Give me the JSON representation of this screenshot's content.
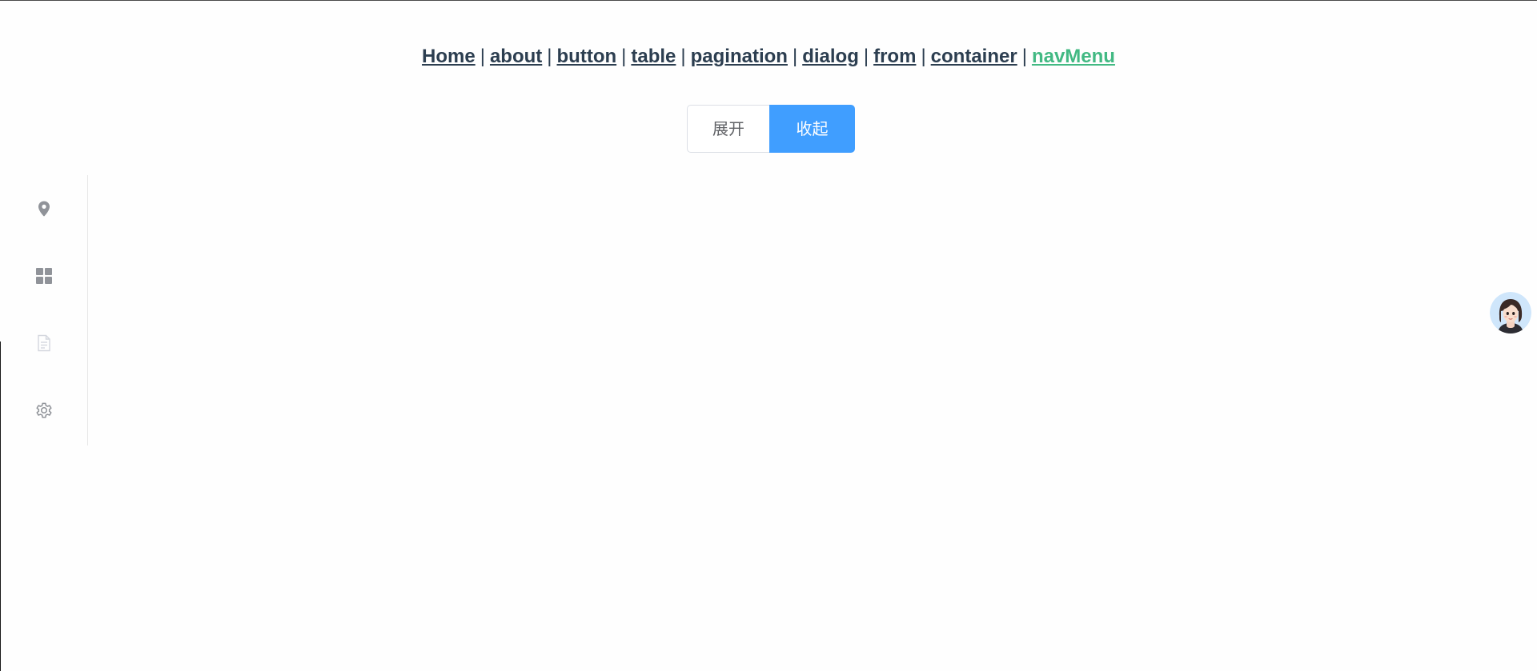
{
  "nav": {
    "links": [
      {
        "label": "Home"
      },
      {
        "label": "about"
      },
      {
        "label": "button"
      },
      {
        "label": "table"
      },
      {
        "label": "pagination"
      },
      {
        "label": "dialog"
      },
      {
        "label": "from"
      },
      {
        "label": "container"
      },
      {
        "label": "navMenu"
      }
    ],
    "separator": "|",
    "active_index": 8,
    "active_color": "#42b983",
    "link_color": "#2c3e50"
  },
  "toggle": {
    "expand_label": "展开",
    "collapse_label": "收起",
    "selected": "collapse",
    "primary_color": "#409eff"
  },
  "menu": {
    "collapsed": true,
    "items": [
      {
        "icon": "location-icon",
        "disabled": false
      },
      {
        "icon": "grid-menu-icon",
        "disabled": false
      },
      {
        "icon": "document-icon",
        "disabled": true
      },
      {
        "icon": "setting-icon",
        "disabled": false
      }
    ],
    "icon_color": "#909399",
    "disabled_icon_color": "#c0c4cc"
  },
  "avatar": {
    "icon": "avatar-icon"
  }
}
